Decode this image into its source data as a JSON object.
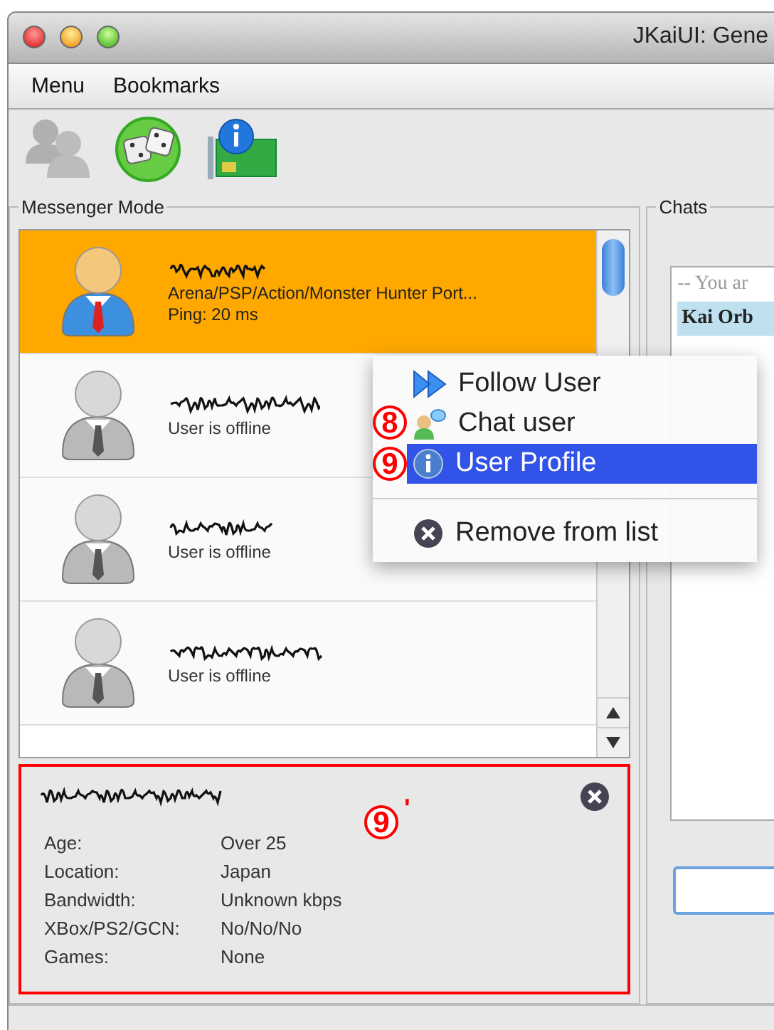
{
  "window": {
    "title": "JKaiUI: Gene"
  },
  "menu_bar": [
    "Menu",
    "Bookmarks"
  ],
  "toolbar": [
    {
      "kind": "people",
      "disabled": true
    },
    {
      "kind": "dice",
      "disabled": false
    },
    {
      "kind": "info",
      "disabled": false
    }
  ],
  "messenger_panel": {
    "title": "Messenger Mode",
    "contacts": [
      {
        "selected": true,
        "online": true,
        "lines": [
          "Arena/PSP/Action/Monster Hunter Port...",
          "Ping: 20 ms"
        ]
      },
      {
        "selected": false,
        "online": false,
        "lines": [
          "User is offline"
        ]
      },
      {
        "selected": false,
        "online": false,
        "lines": [
          "User is offline"
        ]
      },
      {
        "selected": false,
        "online": false,
        "lines": [
          "User is offline"
        ]
      }
    ],
    "profile": {
      "highlighted": true,
      "fields": [
        {
          "label": "Age:",
          "value": "Over 25"
        },
        {
          "label": "Location:",
          "value": "Japan"
        },
        {
          "label": "Bandwidth:",
          "value": "Unknown kbps"
        },
        {
          "label": "XBox/PS2/GCN:",
          "value": "No/No/No"
        },
        {
          "label": "Games:",
          "value": "None"
        }
      ]
    }
  },
  "chats_panel": {
    "title": "Chats",
    "lines": [
      {
        "kind": "notice",
        "text": "-- You ar"
      },
      {
        "kind": "header",
        "text": "Kai Orb"
      }
    ]
  },
  "context_menu": [
    {
      "kind": "follow",
      "label": "Follow User",
      "selected": false,
      "separator_before": false
    },
    {
      "kind": "chat",
      "label": "Chat user",
      "selected": false,
      "separator_before": false
    },
    {
      "kind": "info",
      "label": "User Profile",
      "selected": true,
      "separator_before": false
    },
    {
      "kind": "remove",
      "label": "Remove from list",
      "selected": false,
      "separator_before": true
    }
  ],
  "annotations": [
    {
      "label": "8"
    },
    {
      "label": "9"
    },
    {
      "label": "9",
      "mark": "'"
    }
  ]
}
